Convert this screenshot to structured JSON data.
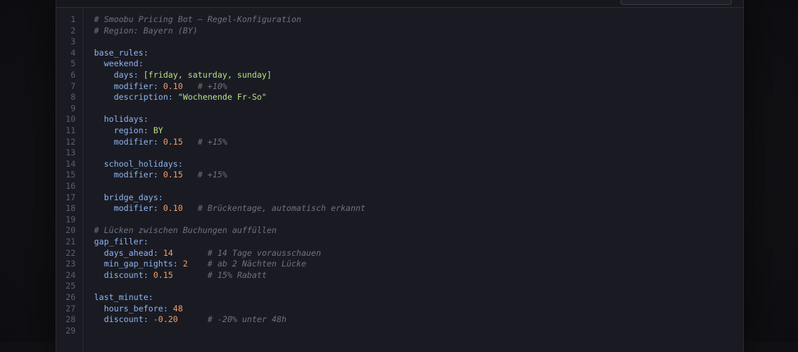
{
  "editor": {
    "language": "yaml",
    "lines": [
      {
        "n": "1",
        "indent": "",
        "parts": [
          {
            "t": "cmt",
            "v": "# Smoobu Pricing Bot — Regel-Konfiguration"
          }
        ]
      },
      {
        "n": "2",
        "indent": "",
        "parts": [
          {
            "t": "cmt",
            "v": "# Region: Bayern (BY)"
          }
        ]
      },
      {
        "n": "3",
        "indent": "",
        "parts": []
      },
      {
        "n": "4",
        "indent": "",
        "parts": [
          {
            "t": "key",
            "v": "base_rules:"
          }
        ]
      },
      {
        "n": "5",
        "indent": "  ",
        "parts": [
          {
            "t": "key",
            "v": "weekend:"
          }
        ]
      },
      {
        "n": "6",
        "indent": "    ",
        "parts": [
          {
            "t": "key",
            "v": "days: "
          },
          {
            "t": "str",
            "v": "[friday, saturday, sunday]"
          }
        ]
      },
      {
        "n": "7",
        "indent": "    ",
        "parts": [
          {
            "t": "key",
            "v": "modifier: "
          },
          {
            "t": "num",
            "v": "0.10"
          },
          {
            "t": "pad",
            "v": "   "
          },
          {
            "t": "cmt",
            "v": "# +10%"
          }
        ]
      },
      {
        "n": "8",
        "indent": "    ",
        "parts": [
          {
            "t": "key",
            "v": "description: "
          },
          {
            "t": "str",
            "v": "\"Wochenende Fr-So\""
          }
        ]
      },
      {
        "n": "9",
        "indent": "",
        "parts": []
      },
      {
        "n": "10",
        "indent": "  ",
        "parts": [
          {
            "t": "key",
            "v": "holidays:"
          }
        ]
      },
      {
        "n": "11",
        "indent": "    ",
        "parts": [
          {
            "t": "key",
            "v": "region: "
          },
          {
            "t": "str",
            "v": "BY"
          }
        ]
      },
      {
        "n": "12",
        "indent": "    ",
        "parts": [
          {
            "t": "key",
            "v": "modifier: "
          },
          {
            "t": "num",
            "v": "0.15"
          },
          {
            "t": "pad",
            "v": "   "
          },
          {
            "t": "cmt",
            "v": "# +15%"
          }
        ]
      },
      {
        "n": "13",
        "indent": "",
        "parts": []
      },
      {
        "n": "14",
        "indent": "  ",
        "parts": [
          {
            "t": "key",
            "v": "school_holidays:"
          }
        ]
      },
      {
        "n": "15",
        "indent": "    ",
        "parts": [
          {
            "t": "key",
            "v": "modifier: "
          },
          {
            "t": "num",
            "v": "0.15"
          },
          {
            "t": "pad",
            "v": "   "
          },
          {
            "t": "cmt",
            "v": "# +15%"
          }
        ]
      },
      {
        "n": "16",
        "indent": "",
        "parts": []
      },
      {
        "n": "17",
        "indent": "  ",
        "parts": [
          {
            "t": "key",
            "v": "bridge_days:"
          }
        ]
      },
      {
        "n": "18",
        "indent": "    ",
        "parts": [
          {
            "t": "key",
            "v": "modifier: "
          },
          {
            "t": "num",
            "v": "0.10"
          },
          {
            "t": "pad",
            "v": "   "
          },
          {
            "t": "cmt",
            "v": "# Brückentage, automatisch erkannt"
          }
        ]
      },
      {
        "n": "19",
        "indent": "",
        "parts": []
      },
      {
        "n": "20",
        "indent": "",
        "parts": [
          {
            "t": "cmt",
            "v": "# Lücken zwischen Buchungen auffüllen"
          }
        ]
      },
      {
        "n": "21",
        "indent": "",
        "parts": [
          {
            "t": "key",
            "v": "gap_filler:"
          }
        ]
      },
      {
        "n": "22",
        "indent": "  ",
        "parts": [
          {
            "t": "key",
            "v": "days_ahead: "
          },
          {
            "t": "num",
            "v": "14"
          },
          {
            "t": "pad",
            "v": "       "
          },
          {
            "t": "cmt",
            "v": "# 14 Tage vorausschauen"
          }
        ]
      },
      {
        "n": "23",
        "indent": "  ",
        "parts": [
          {
            "t": "key",
            "v": "min_gap_nights: "
          },
          {
            "t": "num",
            "v": "2"
          },
          {
            "t": "pad",
            "v": "    "
          },
          {
            "t": "cmt",
            "v": "# ab 2 Nächten Lücke"
          }
        ]
      },
      {
        "n": "24",
        "indent": "  ",
        "parts": [
          {
            "t": "key",
            "v": "discount: "
          },
          {
            "t": "num",
            "v": "0.15"
          },
          {
            "t": "pad",
            "v": "       "
          },
          {
            "t": "cmt",
            "v": "# 15% Rabatt"
          }
        ]
      },
      {
        "n": "25",
        "indent": "",
        "parts": []
      },
      {
        "n": "26",
        "indent": "",
        "parts": [
          {
            "t": "key",
            "v": "last_minute:"
          }
        ]
      },
      {
        "n": "27",
        "indent": "  ",
        "parts": [
          {
            "t": "key",
            "v": "hours_before: "
          },
          {
            "t": "num",
            "v": "48"
          }
        ]
      },
      {
        "n": "28",
        "indent": "  ",
        "parts": [
          {
            "t": "key",
            "v": "discount: "
          },
          {
            "t": "num",
            "v": "-0.20"
          },
          {
            "t": "pad",
            "v": "      "
          },
          {
            "t": "cmt",
            "v": "# -20% unter 48h"
          }
        ]
      },
      {
        "n": "29",
        "indent": "",
        "parts": []
      }
    ]
  },
  "colors": {
    "background": "#111115",
    "editor_bg": "#1a1b22",
    "line_number": "#5c5f6e",
    "key": "#8fb4f5",
    "number": "#f59e6e",
    "string": "#b8e08a",
    "comment": "#6e7180"
  }
}
